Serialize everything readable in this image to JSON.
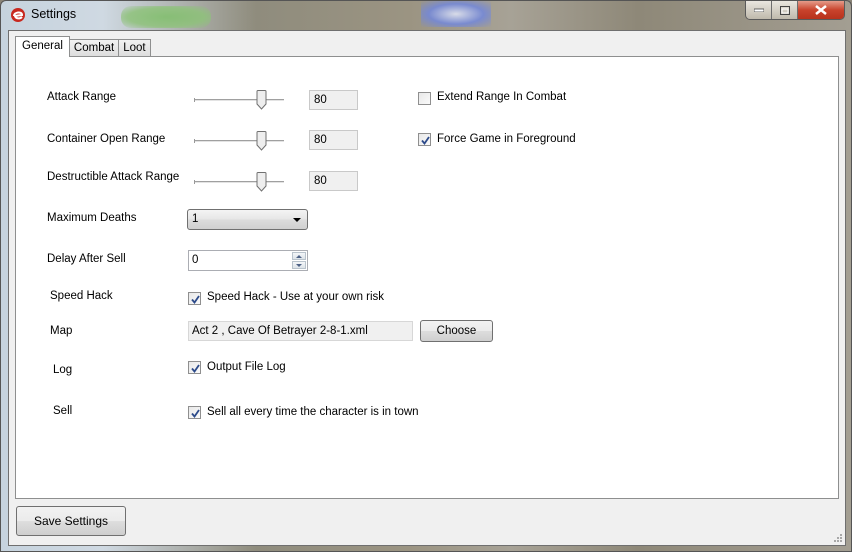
{
  "window": {
    "title": "Settings",
    "app_icon": "e-logo-icon",
    "controls": [
      "minimize",
      "maximize",
      "close"
    ]
  },
  "tabs": [
    {
      "label": "General",
      "active": true
    },
    {
      "label": "Combat",
      "active": false
    },
    {
      "label": "Loot",
      "active": false
    }
  ],
  "general": {
    "sliders": [
      {
        "label": "Attack Range",
        "value": "80",
        "fraction": 0.78
      },
      {
        "label": "Container Open Range",
        "value": "80",
        "fraction": 0.78
      },
      {
        "label": "Destructible Attack Range",
        "value": "80",
        "fraction": 0.78
      }
    ],
    "side_checks": [
      {
        "label": "Extend Range In Combat",
        "checked": false
      },
      {
        "label": "Force Game in Foreground",
        "checked": true
      }
    ],
    "max_deaths": {
      "label": "Maximum Deaths",
      "value": "1"
    },
    "delay_after_sell": {
      "label": "Delay After Sell",
      "value": "0"
    },
    "speed_hack": {
      "label": "Speed Hack",
      "check_label": "Speed Hack - Use at your own risk",
      "checked": true
    },
    "map": {
      "label": "Map",
      "value": "Act 2 , Cave Of Betrayer 2-8-1.xml",
      "choose_label": "Choose"
    },
    "log": {
      "label": "Log",
      "check_label": "Output File Log",
      "checked": true
    },
    "sell": {
      "label": "Sell",
      "check_label": "Sell all every time the character is in town",
      "checked": true
    }
  },
  "footer": {
    "save_label": "Save Settings"
  }
}
